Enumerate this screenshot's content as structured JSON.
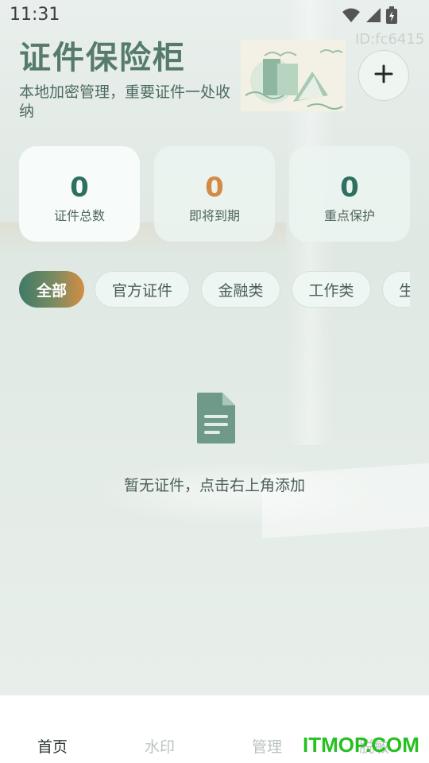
{
  "status": {
    "time": "11:31",
    "icons": [
      "wifi-icon",
      "cell-signal-icon",
      "battery-charging-icon"
    ]
  },
  "header": {
    "title": "证件保险柜",
    "subtitle": "本地加密管理，重要证件一处收纳",
    "id_text": "ID:fc6415",
    "add_icon": "plus-icon"
  },
  "stats": [
    {
      "value": "0",
      "label": "证件总数",
      "color": "#2e6f5f"
    },
    {
      "value": "0",
      "label": "即将到期",
      "color": "#d48a45"
    },
    {
      "value": "0",
      "label": "重点保护",
      "color": "#2e6f5f"
    }
  ],
  "categories": [
    {
      "label": "全部",
      "active": true
    },
    {
      "label": "官方证件",
      "active": false
    },
    {
      "label": "金融类",
      "active": false
    },
    {
      "label": "工作类",
      "active": false
    },
    {
      "label": "生",
      "active": false
    }
  ],
  "empty": {
    "icon": "document-icon",
    "text": "暂无证件，点击右上角添加"
  },
  "tabs": [
    {
      "label": "首页",
      "active": true
    },
    {
      "label": "水印",
      "active": false
    },
    {
      "label": "管理",
      "active": false
    },
    {
      "label": "脱敏",
      "active": false
    }
  ],
  "watermark": "ITMOP.COM",
  "colors": {
    "accent": "#567b6c",
    "warning": "#d48a45",
    "brand_green": "#27c021"
  }
}
